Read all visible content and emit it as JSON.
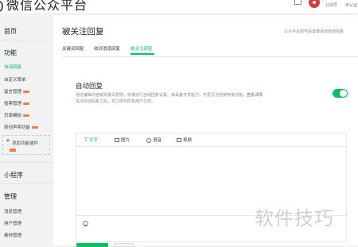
{
  "topbar": {
    "logo_text": "微信公众平台",
    "user_links": [
      "订阅号",
      "未认证"
    ]
  },
  "sidebar": {
    "groups": {
      "home": "首页",
      "features": "功能",
      "mini_program": "小程序",
      "manage": "管理"
    },
    "feature_items": [
      {
        "label": "自动回复",
        "active": true,
        "new": false
      },
      {
        "label": "自定义菜单",
        "active": false,
        "new": false
      },
      {
        "label": "留言管理",
        "active": false,
        "new": true
      },
      {
        "label": "投票管理",
        "active": false,
        "new": true
      },
      {
        "label": "页面模板",
        "active": false,
        "new": true
      },
      {
        "label": "原创声明功能",
        "active": false,
        "new": true
      }
    ],
    "add_plugin": "添加功能插件",
    "manage_items": [
      "消息管理",
      "用户管理",
      "素材管理"
    ]
  },
  "main": {
    "title": "被关注回复",
    "note": "公众平台如何设置被添加自动回复",
    "tabs": [
      {
        "label": "关键词回复",
        "active": false
      },
      {
        "label": "收到消息回复",
        "active": false
      },
      {
        "label": "被关注回复",
        "active": true
      }
    ],
    "section_title": "自动回复",
    "section_desc": "通过编辑内容或关键词规则，快速进行自动回复设置。如具备开发能力，可更灵活地使用该功能。",
    "section_link": "查看详情",
    "section_desc_2": "关闭自动回复之后，将立即对所有用户生效。",
    "toggle_on": true,
    "editor_tabs": [
      {
        "icon": "text-icon",
        "label": "文字",
        "active": true
      },
      {
        "icon": "image-icon",
        "label": "图片",
        "active": false
      },
      {
        "icon": "voice-icon",
        "label": "语音",
        "active": false
      },
      {
        "icon": "video-icon",
        "label": "视频",
        "active": false
      }
    ],
    "editor_value": ""
  },
  "watermark": "软件技巧",
  "colors": {
    "accent": "#07c160",
    "badge": "#f07c49",
    "link": "#576b95"
  }
}
